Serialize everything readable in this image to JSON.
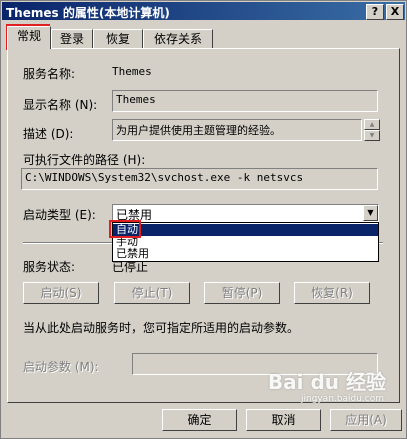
{
  "window": {
    "title": "Themes 的属性(本地计算机)",
    "help_label": "?",
    "close_label": "X"
  },
  "tabs": [
    {
      "label": "常规",
      "active": true
    },
    {
      "label": "登录"
    },
    {
      "label": "恢复"
    },
    {
      "label": "依存关系"
    }
  ],
  "general": {
    "service_name_label": "服务名称:",
    "service_name_value": "Themes",
    "display_name_label": "显示名称 (N):",
    "display_name_value": "Themes",
    "description_label": "描述 (D):",
    "description_value": "为用户提供使用主题管理的经验。",
    "exe_path_label": "可执行文件的路径 (H):",
    "exe_path_value": "C:\\WINDOWS\\System32\\svchost.exe -k netsvcs",
    "startup_type_label": "启动类型 (E):",
    "startup_type_value": "已禁用",
    "startup_options": [
      "自动",
      "手动",
      "已禁用"
    ],
    "startup_selected_option": "自动",
    "service_status_label": "服务状态:",
    "service_status_value": "已停止",
    "start_button": "启动(S)",
    "stop_button": "停止(T)",
    "pause_button": "暂停(P)",
    "resume_button": "恢复(R)",
    "hint_text": "当从此处启动服务时，您可指定所适用的启动参数。",
    "start_params_label": "启动参数 (M):",
    "start_params_value": ""
  },
  "footer": {
    "ok_button": "确定",
    "cancel_button": "取消",
    "apply_button": "应用(A)"
  },
  "watermark": {
    "logo_text": "Bai du 经验",
    "url_text": "jingyan.baidu.com"
  },
  "colors": {
    "highlight_box": "#e02020",
    "title_bar": "#0a246a",
    "selection": "#0a246a"
  }
}
